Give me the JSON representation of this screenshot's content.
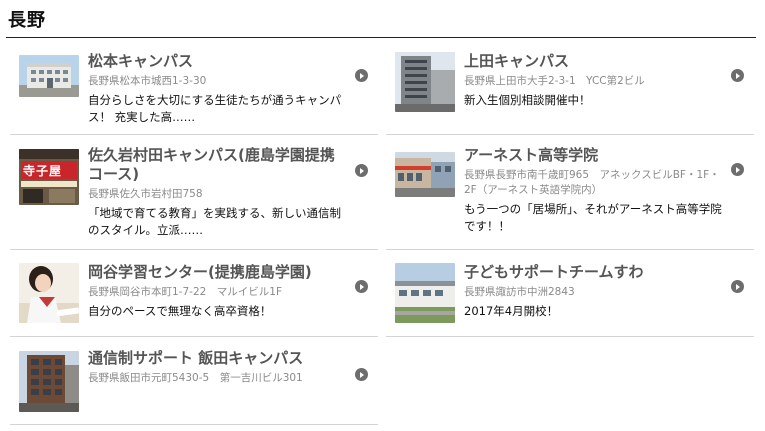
{
  "region": {
    "title": "長野"
  },
  "campuses": [
    {
      "name": "松本キャンパス",
      "address": "長野県松本市城西1-3-30",
      "description": "自分らしさを大切にする生徒たちが通うキャンパス！ 充実した高……",
      "photo_icon": "building-photo"
    },
    {
      "name": "上田キャンパス",
      "address": "長野県上田市大手2-3-1　YCC第2ビル",
      "description": "新入生個別相談開催中！",
      "photo_icon": "building-photo"
    },
    {
      "name": "佐久岩村田キャンパス(鹿島学園提携コース)",
      "address": "長野県佐久市岩村田758",
      "description": "「地域で育てる教育」を実践する、新しい通信制のスタイル。立派……",
      "photo_icon": "storefront-sign-photo",
      "photo_sign_text": "寺子屋"
    },
    {
      "name": "アーネスト高等学院",
      "address": "長野県長野市南千歳町965　アネックスビルBF・1F・2F（アーネスト英語学院内）",
      "description": "もう一つの「居場所」、それがアーネスト高等学院です！！",
      "photo_icon": "street-building-photo"
    },
    {
      "name": "岡谷学習センター(提携鹿島学園)",
      "address": "長野県岡谷市本町1-7-22　マルイビル1F",
      "description": "自分のペースで無理なく高卒資格！",
      "photo_icon": "student-studying-photo"
    },
    {
      "name": "子どもサポートチームすわ",
      "address": "長野県諏訪市中洲2843",
      "description": "2017年4月開校！",
      "photo_icon": "building-photo"
    },
    {
      "name": "通信制サポート 飯田キャンパス",
      "address": "長野県飯田市元町5430-5　第一吉川ビル301",
      "description": "",
      "photo_icon": "tall-building-photo"
    }
  ],
  "colors": {
    "title": "#111111",
    "name": "#555555",
    "address": "#8a8a8a",
    "arrow": "#6d6d6d",
    "divider": "#d4d4d4"
  },
  "arrow_icon": "play-circle-icon"
}
